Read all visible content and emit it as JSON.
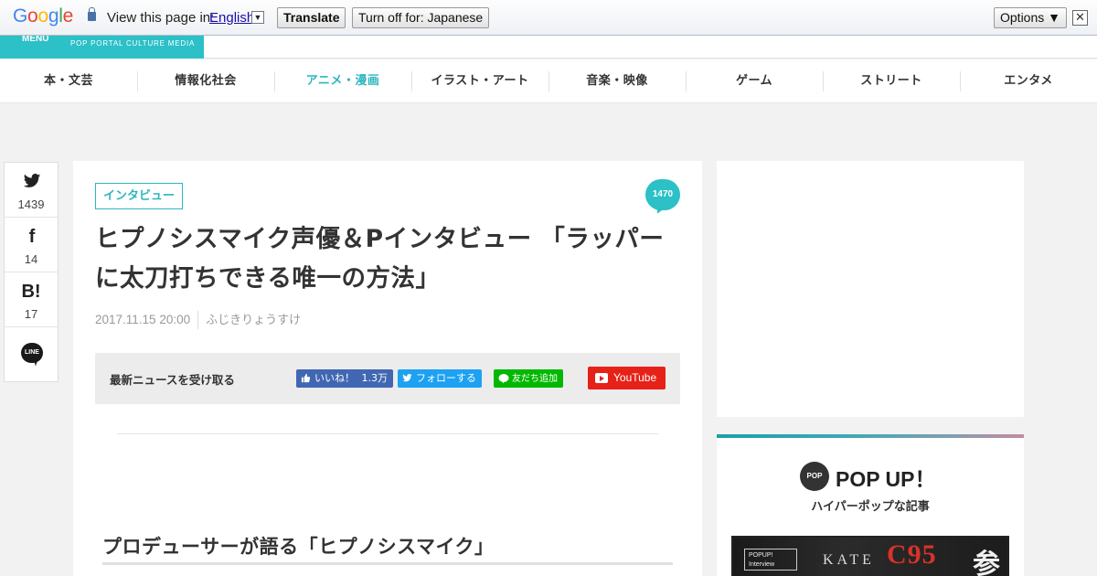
{
  "translate_bar": {
    "logo": "Google",
    "view_text": "View this page in:",
    "language": "English",
    "dropdown_glyph": "▼",
    "translate_label": "Translate",
    "turn_off_label": "Turn off for: Japanese",
    "options_label": "Options ▼",
    "close_glyph": "✕"
  },
  "header": {
    "menu_label": "MENU",
    "tagline": "POP PORTAL CULTURE MEDIA",
    "accent_color": "#2cc0c7"
  },
  "categories": [
    {
      "label": "本・文芸",
      "active": false
    },
    {
      "label": "情報化社会",
      "active": false
    },
    {
      "label": "アニメ・漫画",
      "active": true
    },
    {
      "label": "イラスト・アート",
      "active": false
    },
    {
      "label": "音楽・映像",
      "active": false
    },
    {
      "label": "ゲーム",
      "active": false
    },
    {
      "label": "ストリート",
      "active": false
    },
    {
      "label": "エンタメ",
      "active": false
    }
  ],
  "share": {
    "twitter": {
      "icon": "twitter-icon",
      "count": "1439"
    },
    "facebook": {
      "icon": "facebook-icon",
      "glyph": "f",
      "count": "14"
    },
    "hatena": {
      "icon": "hatena-bookmark-icon",
      "glyph": "B!",
      "count": "17"
    },
    "line": {
      "icon": "line-icon",
      "glyph": "LINE"
    }
  },
  "article": {
    "tag": "インタビュー",
    "comment_count": "1470",
    "title": "ヒプノシスマイク声優＆Pインタビュー 「ラッパーに太刀打ちできる唯一の方法」",
    "date": "2017.11.15 20:00",
    "author": "ふじきりょうすけ",
    "section_heading": "プロデューサーが語る「ヒプノシスマイク」"
  },
  "follow": {
    "label": "最新ニュースを受け取る",
    "facebook_label": "いいね！",
    "facebook_count": "1.3万",
    "twitter_label": "フォローする",
    "line_label": "友だち追加",
    "youtube_label": "YouTube"
  },
  "sidebar": {
    "popup_badge": "POP",
    "popup_title": "POP UP！",
    "popup_subtitle": "ハイパーポップな記事",
    "banner_label": "POPUP! Interview",
    "banner_name": "KATE",
    "banner_event": "C95",
    "banner_kanji": "参"
  }
}
